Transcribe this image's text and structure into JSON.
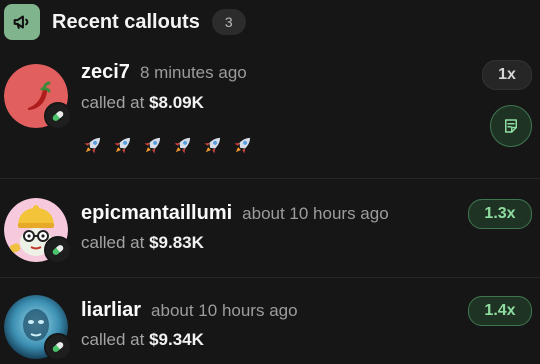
{
  "header": {
    "title": "Recent callouts",
    "count": "3",
    "icon": "megaphone-icon",
    "icon_bg": "#7fb48c"
  },
  "callouts": [
    {
      "username": "zeci7",
      "time": "8 minutes ago",
      "called_prefix": "called at",
      "amount": "$8.09K",
      "multiplier": "1x",
      "multiplier_style": "neutral",
      "avatar": "chili-pepper-avatar",
      "reactions": [
        "rocket",
        "rocket",
        "rocket",
        "rocket",
        "rocket",
        "rocket"
      ],
      "action_icon": "note-icon"
    },
    {
      "username": "epicmantaillumi",
      "time": "about 10 hours ago",
      "called_prefix": "called at",
      "amount": "$9.83K",
      "multiplier": "1.3x",
      "multiplier_style": "green",
      "avatar": "cartoon-character-avatar"
    },
    {
      "username": "liarliar",
      "time": "about 10 hours ago",
      "called_prefix": "called at",
      "amount": "$9.34K",
      "multiplier": "1.4x",
      "multiplier_style": "green",
      "avatar": "blue-face-avatar"
    }
  ],
  "colors": {
    "background": "#161616",
    "green_accent": "#8fdca1",
    "green_border": "#3f7650"
  }
}
